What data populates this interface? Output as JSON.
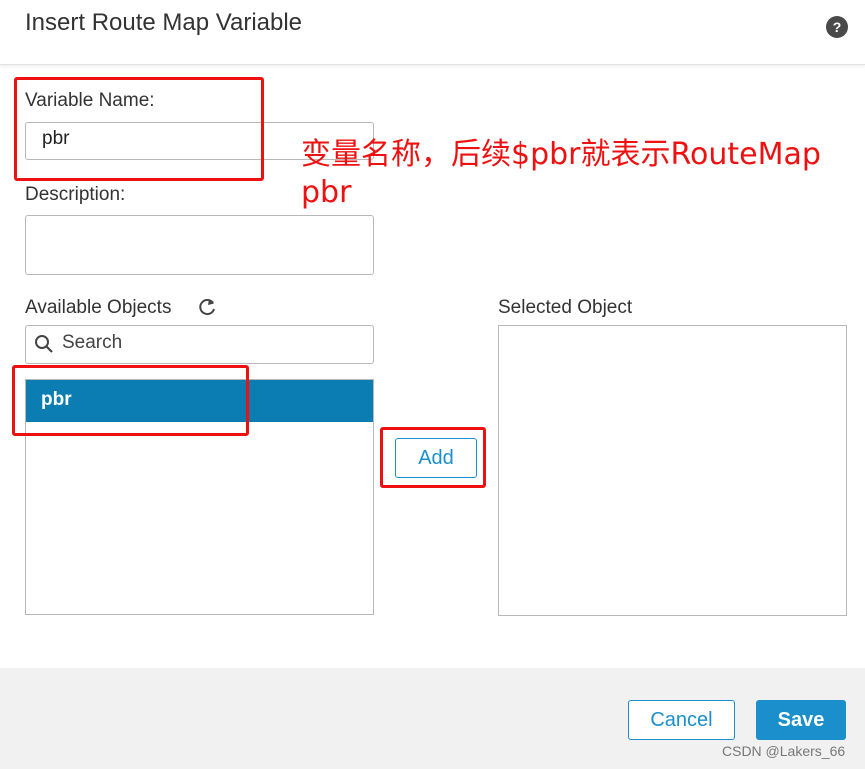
{
  "dialog": {
    "title": "Insert Route Map Variable",
    "help_icon": "help-icon",
    "help_glyph": "?"
  },
  "form": {
    "variable_name_label": "Variable Name:",
    "variable_name_value": "pbr",
    "description_label": "Description:",
    "description_value": "",
    "available_objects_label": "Available Objects",
    "refresh_icon": "refresh-icon",
    "search_icon": "search-icon",
    "search_placeholder": "Search",
    "available_items": [
      {
        "label": "pbr",
        "selected": true
      }
    ],
    "add_label": "Add",
    "selected_object_label": "Selected Object",
    "selected_items": []
  },
  "annotation": {
    "text": "变量名称，后续$pbr就表示RouteMap pbr"
  },
  "footer": {
    "cancel_label": "Cancel",
    "save_label": "Save"
  },
  "watermark": "CSDN @Lakers_66",
  "colors": {
    "accent": "#1a8fcc",
    "selected_row": "#0b7db3",
    "annotation_red": "#ee1111",
    "footer_bg": "#f1f1f1"
  }
}
